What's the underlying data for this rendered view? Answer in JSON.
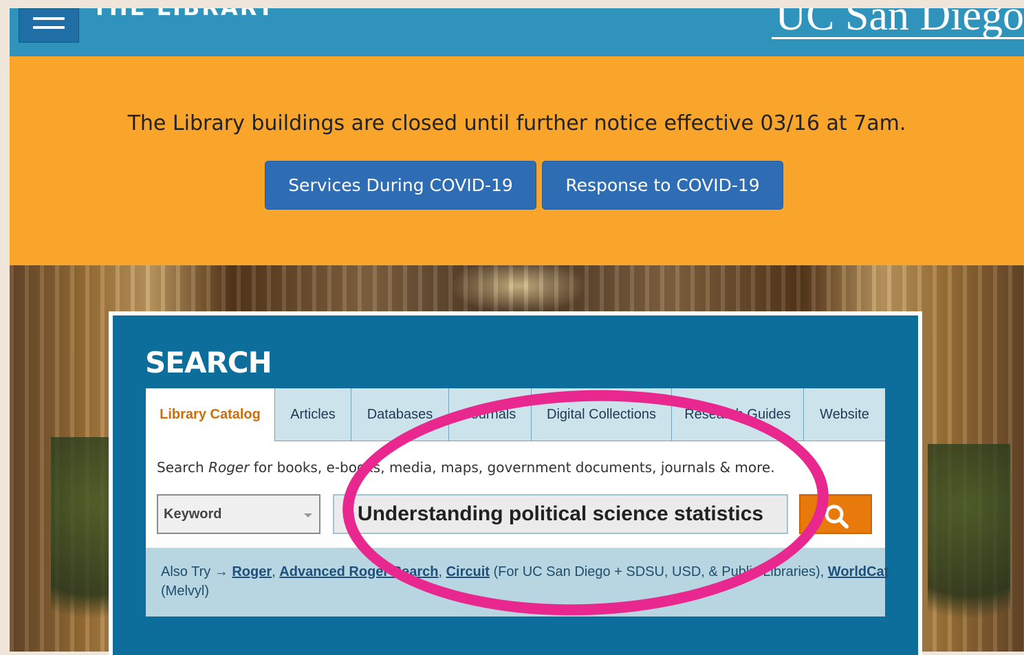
{
  "header": {
    "site_title": "THE LIBRARY",
    "brand": "UC San Diego"
  },
  "alert": {
    "message": "The Library buildings are closed until further notice effective 03/16 at 7am.",
    "buttons": [
      "Services During COVID-19",
      "Response to COVID-19"
    ]
  },
  "search": {
    "title": "SEARCH",
    "tabs": [
      {
        "label": "Library Catalog",
        "active": true
      },
      {
        "label": "Articles",
        "active": false
      },
      {
        "label": "Databases",
        "active": false
      },
      {
        "label": "Journals",
        "active": false
      },
      {
        "label": "Digital Collections",
        "active": false
      },
      {
        "label": "Research Guides",
        "active": false
      },
      {
        "label": "Website",
        "active": false
      }
    ],
    "description_prefix": "Search ",
    "description_italic": "Roger",
    "description_suffix": " for books, e-books, media, maps, government documents, journals & more.",
    "type_select": "Keyword",
    "query": "Understanding political science statistics",
    "also_try": {
      "label": "Also Try →",
      "links": [
        "Roger",
        "Advanced Roger Search",
        "Circuit",
        "WorldCat"
      ],
      "circuit_note": "(For UC San Diego + SDSU, USD, & Public Libraries),",
      "worldcat_note": "(Melvyl)"
    }
  },
  "colors": {
    "header": "#2f93bb",
    "alert": "#f9a42a",
    "button": "#2e6db3",
    "panel": "#0d6d9b",
    "go_button": "#e8790b",
    "highlight": "#e8288f"
  },
  "icons": {
    "menu": "hamburger-menu-icon",
    "search": "magnifier-icon"
  }
}
